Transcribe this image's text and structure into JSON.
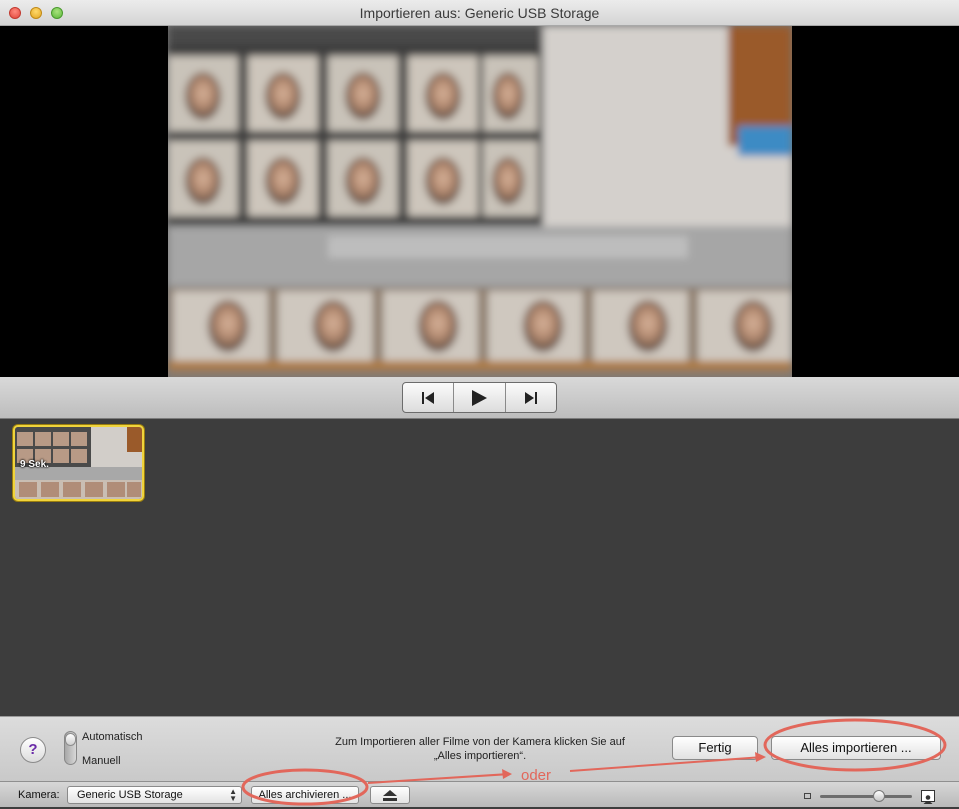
{
  "window": {
    "title": "Importieren aus: Generic USB Storage"
  },
  "clips": [
    {
      "duration_label": "9 Sek."
    }
  ],
  "mode": {
    "automatic_label": "Automatisch",
    "manual_label": "Manuell",
    "selected": "Automatisch"
  },
  "help": {
    "label": "?"
  },
  "hint": {
    "line1": "Zum Importieren aller Filme von der Kamera klicken Sie auf",
    "line2": "„Alles importieren“."
  },
  "buttons": {
    "done_label": "Fertig",
    "import_all_label": "Alles importieren ..."
  },
  "statusbar": {
    "camera_label": "Kamera:",
    "camera_value": "Generic USB Storage",
    "archive_label": "Alles archivieren ..."
  },
  "annotation": {
    "text": "oder",
    "color": "#e2675b"
  },
  "colors": {
    "clip_selection": "#f0d43c",
    "annotation": "#e2675b"
  }
}
